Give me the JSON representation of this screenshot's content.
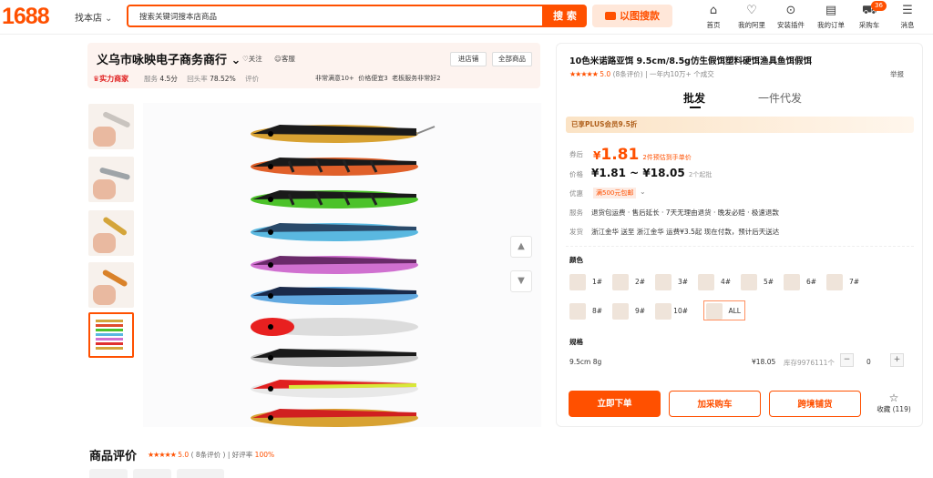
{
  "header": {
    "logo": "1688",
    "find_shop": "找本店",
    "search_placeholder": "搜索关键词搜本店商品",
    "search_button": "搜 索",
    "image_search": "以图搜款",
    "nav": [
      {
        "label": "首页",
        "icon": "home-icon"
      },
      {
        "label": "我的阿里",
        "icon": "heart-shield-icon"
      },
      {
        "label": "安装插件",
        "icon": "plugin-icon"
      },
      {
        "label": "我的订单",
        "icon": "order-icon"
      },
      {
        "label": "采购车",
        "icon": "cart-icon",
        "badge": "36"
      },
      {
        "label": "消息",
        "icon": "message-icon"
      }
    ]
  },
  "shop": {
    "name": "义乌市咏映电子商务商行",
    "follow": "关注",
    "service": "客服",
    "enter_shop": "进店铺",
    "all_products": "全部商品",
    "strength": "实力商家",
    "stats": [
      {
        "label": "服务",
        "value": "4.5分"
      },
      {
        "label": "回头率",
        "value": "78.52%"
      },
      {
        "label": "评价",
        "value": ""
      }
    ],
    "tags": [
      "非常满意10+",
      "价格便宜3",
      "老板服务非常好2"
    ]
  },
  "product": {
    "title": "10色米诺路亚饵 9.5cm/8.5g仿生假饵塑料硬饵渔具鱼饵假饵",
    "rating": "5.0",
    "reviews": "(8条评价)",
    "sold": "一年内10万+ 个成交",
    "report": "举报",
    "tabs": [
      "批发",
      "一件代发"
    ],
    "plus_banner": "已享PLUS会员9.5折",
    "coupon_label": "券后",
    "coupon_yen": "¥",
    "coupon_price": "1.81",
    "coupon_note": "2件预估到手单价",
    "price_label": "价格",
    "price_range": "¥1.81 ~ ¥18.05",
    "min_order": "2个起批",
    "discount_label": "优惠",
    "discount_tag": "满500元包邮",
    "service_label": "服务",
    "service_text": "退货包运费 · 售后延长 · 7天无理由退货 · 晚发必赔 · 极速退款",
    "ship_label": "发货",
    "ship_text": "浙江金华 送至 浙江金华  运费¥3.5起  现在付款，预计后天送达",
    "color_label": "颜色",
    "colors": [
      "1#",
      "2#",
      "3#",
      "4#",
      "5#",
      "6#",
      "7#",
      "8#",
      "9#",
      "10#",
      "ALL"
    ],
    "spec_label": "规格",
    "spec_name": "9.5cm 8g",
    "spec_price": "¥18.05",
    "spec_stock": "库存9976111个",
    "quantity": "0",
    "buy_now": "立即下单",
    "add_cart": "加采购车",
    "cross_border": "跨境铺货",
    "favorite": "收藏 (119)"
  },
  "reviews_section": {
    "title": "商品评价",
    "score": "5.0",
    "count": "( 8条评价 )",
    "good_rate_label": "好评率",
    "good_rate": "100%"
  },
  "colors": {
    "accent": "#ff5000"
  }
}
